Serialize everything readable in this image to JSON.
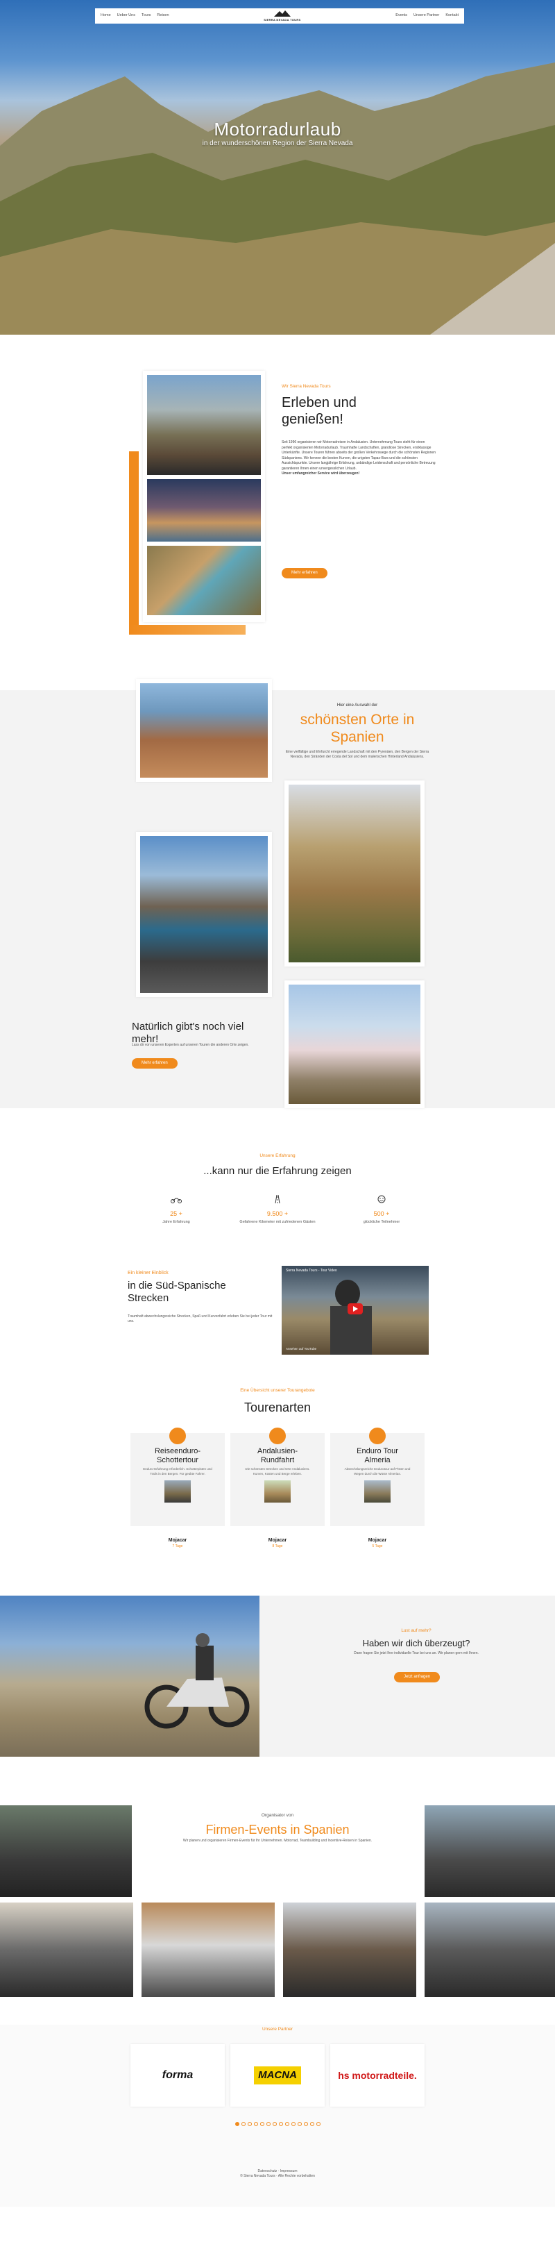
{
  "nav": {
    "links_left": [
      "Home",
      "Ueber Uns",
      "Tours",
      "Reisen"
    ],
    "logo_text": "SIERRA NEVADA TOURS",
    "links_right": [
      "Events",
      "Unsere Partner",
      "Kontakt"
    ]
  },
  "hero": {
    "title": "Motorradurlaub",
    "subtitle": "in der wunderschönen Region der Sierra Nevada"
  },
  "intro": {
    "tagline": "Wir Sierra Nevada Tours",
    "title_line1": "Erleben und",
    "title_line2": "genießen!",
    "paragraph": "Seit 1996 organisieren wir Motorradreisen in Andalusien. Unternehmung Tours steht für einen perfekt organisierten Motorradurlaub. Traumhafte Landschaften, grandiose Strecken, erstklassige Unterkünfte. Unsere Touren führen abseits der großen Verkehrswege durch die schönsten Regionen Südspaniens. Wir kennen die besten Kurven, die urigsten Tapas-Bars und die schönsten Aussichtspunkte. Unsere langjährige Erfahrung, unbändige Leidenschaft und persönliche Betreuung garantieren Ihnen einen unvergesslichen Urlaub.",
    "closing": "Unser umfangreicher Service wird überzeugen!",
    "button": "Mehr erfahren"
  },
  "places": {
    "lead": "Hier eine Auswahl der",
    "title_line1": "schönsten Orte in",
    "title_line2": "Spanien",
    "description": "Eine vielfältige und Ehrfurcht erregende Landschaft mit den Pyrenäen, den Bergen der Sierra Nevada, den Stränden der Costa del Sol und dem malerischen Hinterland Andalusiens.",
    "more_title_line1": "Natürlich gibt's noch viel",
    "more_title_line2": "mehr!",
    "more_sub": "Lass dir von unseren Experten auf unseren Touren die anderen Orte zeigen.",
    "more_button": "Mehr erfahren"
  },
  "experience": {
    "lead": "Unsere Erfahrung",
    "title": "...kann nur die Erfahrung zeigen",
    "stats": [
      {
        "icon": "motorcycle-icon",
        "value": "25 +",
        "label": "Jahre Erfahrung"
      },
      {
        "icon": "road-icon",
        "value": "9.500 +",
        "label": "Gefahrene Kilometer mit zufriedenen Gästen"
      },
      {
        "icon": "smile-icon",
        "value": "500 +",
        "label": "glückliche Teilnehmer"
      }
    ]
  },
  "video": {
    "lead": "Ein kleiner Einblick",
    "title_line1": "in die Süd-Spanische",
    "title_line2": "Strecken",
    "description": "Traumhaft abwechslungsreiche Strecken, Spaß und Kurvenfahrt erleben Sie bei jeder Tour mit uns.",
    "video_title": "Sierra Nevada Tours - Tour Video",
    "player_label": "Ansehen auf YouTube"
  },
  "tours": {
    "lead": "Eine Übersicht unserer Tourangebote",
    "title": "Tourenarten",
    "items": [
      {
        "name_line1": "Reiseenduro-",
        "name_line2": "Schottertour",
        "desc": "Enduro-Erfahrung erforderlich. Schotterpisten und Trails in den Bergen. Für geübte Fahrer.",
        "loc": "Mojacar",
        "days": "7 Tage"
      },
      {
        "name_line1": "Andalusien-",
        "name_line2": "Rundfahrt",
        "desc": "Die schönsten Strecken und Orte Andalusiens. Kurven, Küsten und Berge erleben.",
        "loc": "Mojacar",
        "days": "8 Tage"
      },
      {
        "name_line1": "Enduro Tour",
        "name_line2": "Almeria",
        "desc": "Abwechslungsreiche Endurotour auf Pisten und Wegen durch die Wüste Almerias.",
        "loc": "Mojacar",
        "days": "5 Tage"
      }
    ]
  },
  "convinced": {
    "lead": "Lust auf mehr?",
    "title": "Haben wir dich überzeugt?",
    "description": "Dann fragen Sie jetzt Ihre individuelle Tour bei uns an. Wir planen gern mit Ihnen.",
    "button": "Jetzt anfragen"
  },
  "events": {
    "lead": "Organisator von",
    "title": "Firmen-Events in Spanien",
    "description": "Wir planen und organisieren Firmen-Events für Ihr Unternehmen. Motorrad, Teambuilding und Incentive-Reisen in Spanien."
  },
  "partners": {
    "lead": "Unsere Partner",
    "logos": [
      "forma",
      "MACNA",
      "hs motorradteile."
    ],
    "dots": 14
  },
  "footer": {
    "links": "Datenschutz · Impressum",
    "copyright": "© Sierra Nevada Tours · Alle Rechte vorbehalten"
  },
  "colors": {
    "accent": "#f08a1c"
  }
}
